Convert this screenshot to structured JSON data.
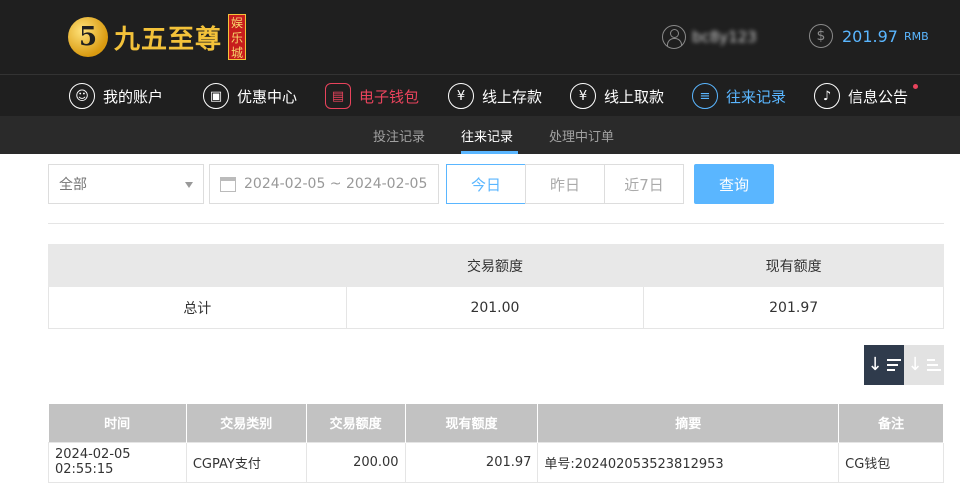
{
  "header": {
    "logo_text": "九五至尊",
    "logo_badge": "娱乐城",
    "username": "bc8y123",
    "balance": "201.97",
    "currency": "RMB"
  },
  "nav": [
    {
      "label": "我的账户",
      "icon": "user-icon"
    },
    {
      "label": "优惠中心",
      "icon": "gift-icon"
    },
    {
      "label": "电子钱包",
      "icon": "wallet-icon"
    },
    {
      "label": "线上存款",
      "icon": "deposit-icon"
    },
    {
      "label": "线上取款",
      "icon": "withdraw-icon"
    },
    {
      "label": "往来记录",
      "icon": "records-icon"
    },
    {
      "label": "信息公告",
      "icon": "bell-icon"
    }
  ],
  "subnav": [
    "投注记录",
    "往来记录",
    "处理中订单"
  ],
  "filter": {
    "type_value": "全部",
    "date_range": "2024-02-05 ~ 2024-02-05",
    "ranges": [
      "今日",
      "昨日",
      "近7日"
    ],
    "query_label": "查询"
  },
  "summary": {
    "headers": [
      "",
      "交易额度",
      "现有额度"
    ],
    "row": [
      "总计",
      "201.00",
      "201.97"
    ]
  },
  "records": {
    "headers": [
      "时间",
      "交易类别",
      "交易额度",
      "现有额度",
      "摘要",
      "备注"
    ],
    "rows": [
      [
        "2024-02-05 02:55:15",
        "CGPAY支付",
        "200.00",
        "201.97",
        "单号:202402053523812953",
        "CG钱包"
      ]
    ]
  },
  "colors": {
    "accent": "#5ab6ff",
    "danger": "#e8435c",
    "gold": "#f3c23a"
  }
}
